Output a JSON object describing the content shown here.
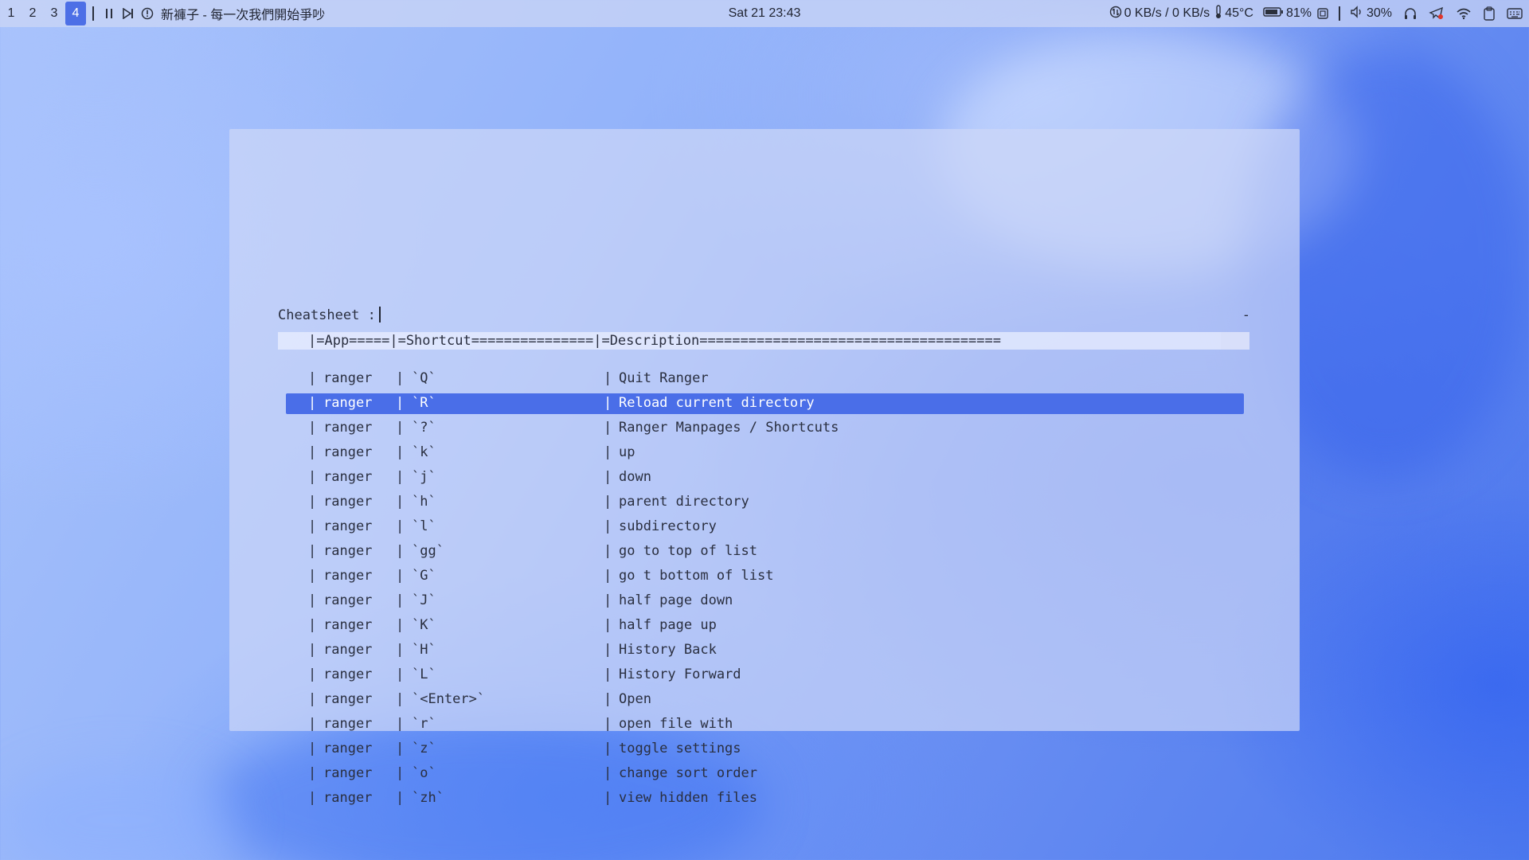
{
  "topbar": {
    "workspaces": [
      {
        "label": "1",
        "active": false
      },
      {
        "label": "2",
        "active": false
      },
      {
        "label": "3",
        "active": false
      },
      {
        "label": "4",
        "active": true
      }
    ],
    "media": {
      "pause_icon": "pause-icon",
      "next_icon": "skip-next-icon",
      "info_icon": "info-circle-icon",
      "title": "新褲子 - 每一次我們開始爭吵"
    },
    "clock": "Sat 21 23:43",
    "tray": {
      "network": "0 KB/s / 0 KB/s",
      "temperature": "45°C",
      "battery": "81%",
      "volume": "30%"
    },
    "accent_color": "#4d6fe6"
  },
  "terminal": {
    "prompt_label": "Cheatsheet :",
    "corner_mark": "-",
    "header": "|=App=====|=Shortcut===============|=Description=====================================",
    "selected_index": 1,
    "selection_color": "#4a6ee8",
    "rows": [
      {
        "app": "ranger",
        "key": "`Q`",
        "desc": "Quit Ranger"
      },
      {
        "app": "ranger",
        "key": "`R`",
        "desc": "Reload current directory"
      },
      {
        "app": "ranger",
        "key": "`?`",
        "desc": "Ranger Manpages / Shortcuts"
      },
      {
        "app": "ranger",
        "key": "`k`",
        "desc": "up"
      },
      {
        "app": "ranger",
        "key": "`j`",
        "desc": "down"
      },
      {
        "app": "ranger",
        "key": "`h`",
        "desc": "parent directory"
      },
      {
        "app": "ranger",
        "key": "`l`",
        "desc": "subdirectory"
      },
      {
        "app": "ranger",
        "key": "`gg`",
        "desc": "go to top of list"
      },
      {
        "app": "ranger",
        "key": "`G`",
        "desc": "go t bottom of list"
      },
      {
        "app": "ranger",
        "key": "`J`",
        "desc": "half page down"
      },
      {
        "app": "ranger",
        "key": "`K`",
        "desc": "half page up"
      },
      {
        "app": "ranger",
        "key": "`H`",
        "desc": "History Back"
      },
      {
        "app": "ranger",
        "key": "`L`",
        "desc": "History Forward"
      },
      {
        "app": "ranger",
        "key": "`<Enter>`",
        "desc": "Open"
      },
      {
        "app": "ranger",
        "key": "`r`",
        "desc": "open file with"
      },
      {
        "app": "ranger",
        "key": "`z`",
        "desc": "toggle settings"
      },
      {
        "app": "ranger",
        "key": "`o`",
        "desc": "change sort order"
      },
      {
        "app": "ranger",
        "key": "`zh`",
        "desc": "view hidden files"
      }
    ]
  }
}
